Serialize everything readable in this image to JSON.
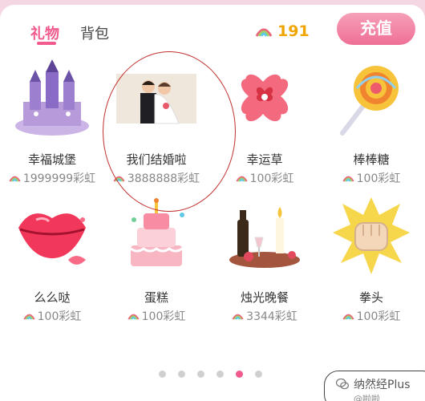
{
  "tabs": {
    "gifts": "礼物",
    "bag": "背包"
  },
  "balance": {
    "icon": "rainbow-icon",
    "amount": "191"
  },
  "recharge_label": "充值",
  "gifts": [
    {
      "name": "幸福城堡",
      "price": "1999999彩虹",
      "icon": "castle-icon"
    },
    {
      "name": "我们结婚啦",
      "price": "3888888彩虹",
      "icon": "wedding-couple-icon"
    },
    {
      "name": "幸运草",
      "price": "100彩虹",
      "icon": "clover-icon"
    },
    {
      "name": "棒棒糖",
      "price": "100彩虹",
      "icon": "lollipop-icon"
    },
    {
      "name": "么么哒",
      "price": "100彩虹",
      "icon": "kiss-lips-icon"
    },
    {
      "name": "蛋糕",
      "price": "100彩虹",
      "icon": "cake-icon"
    },
    {
      "name": "烛光晚餐",
      "price": "3344彩虹",
      "icon": "candlelight-dinner-icon"
    },
    {
      "name": "拳头",
      "price": "100彩虹",
      "icon": "fist-icon"
    }
  ],
  "pager": {
    "total": 6,
    "active": 5
  },
  "watermark": {
    "line1": "纳然经Plus",
    "line2": "@啦啦"
  },
  "colors": {
    "accent": "#f05a8c",
    "balance": "#f0a500",
    "highlight_circle": "#c0302c"
  }
}
